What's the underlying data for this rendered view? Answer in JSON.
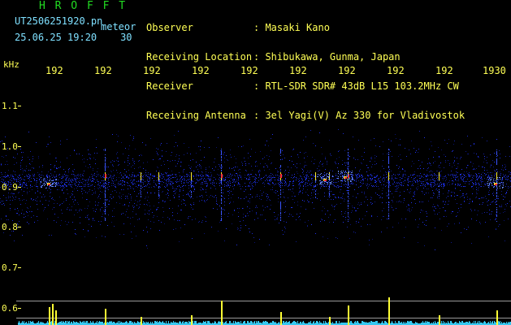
{
  "header": {
    "title": "H R O F F T",
    "filename": "UT2506251920.pn",
    "mode": "meteor",
    "datetime": "25.06.25 19:20",
    "interval": "30"
  },
  "meta": [
    {
      "label": "Observer",
      "value": ": Masaki Kano"
    },
    {
      "label": "Receiving Location",
      "value": ": Shibukawa, Gunma, Japan"
    },
    {
      "label": "Receiver",
      "value": ": RTL-SDR SDR# 43dB L15 103.2MHz CW"
    },
    {
      "label": "Receiving Antenna",
      "value": ": 3el Yagi(V) Az 330 for Vladivostok"
    }
  ],
  "axis": {
    "unit": "kHz",
    "y_ticks": [
      "1.1",
      "1.0",
      "0.9",
      "0.8",
      "0.7",
      "0.6"
    ],
    "x_ticks": [
      "192",
      "192",
      "192",
      "192",
      "192",
      "192",
      "192",
      "192",
      "192",
      "1930"
    ]
  },
  "colors": {
    "text_green": "#22dd22",
    "text_yellow": "#ffff55",
    "text_cyan": "#7fe0ff",
    "signal_high": "#ff3333",
    "signal_mid": "#ffee33",
    "noise": "#1a2bd0"
  }
}
